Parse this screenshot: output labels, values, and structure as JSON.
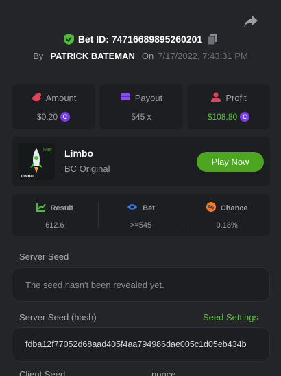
{
  "header": {
    "bet_id": "Bet ID: 74716689895260201",
    "by_label": "By",
    "player_name": "PATRICK BATEMAN",
    "on_label": "On",
    "datetime": "7/17/2022, 7:43:31 PM"
  },
  "stats": [
    {
      "label": "Amount",
      "value": "$0.20",
      "icon": "bet-amount-icon",
      "coin": true,
      "color": "#9aa0a6"
    },
    {
      "label": "Payout",
      "value": "545 x",
      "icon": "wallet-icon",
      "coin": false,
      "color": "#9aa0a6"
    },
    {
      "label": "Profit",
      "value": "$108.80",
      "icon": "profit-icon",
      "coin": true,
      "color": "#55c932"
    }
  ],
  "game": {
    "name": "Limbo",
    "provider": "BC Original",
    "play_label": "Play Now",
    "thumb_text": "LIMBO",
    "thumb_multiplier": "500x"
  },
  "results": [
    {
      "label": "Result",
      "value": "612.6",
      "icon": "chart-icon"
    },
    {
      "label": "Bet",
      "value": ">=545",
      "icon": "target-icon"
    },
    {
      "label": "Chance",
      "value": "0.18%",
      "icon": "percent-icon"
    }
  ],
  "seeds": {
    "server_seed_label": "Server Seed",
    "server_seed_value": "The seed hasn't been revealed yet.",
    "server_hash_label": "Server Seed (hash)",
    "seed_settings_label": "Seed Settings",
    "server_hash_value": "fdba12f77052d68aad405f4aa794986dae005c1d05eb434b",
    "client_seed_label": "Client Seed",
    "nonce_label": "nonce"
  },
  "colors": {
    "accent_green": "#4ca61f",
    "profit_green": "#55c932",
    "coin_purple": "#7a3cf0",
    "panel_bg": "#1c1e21"
  }
}
